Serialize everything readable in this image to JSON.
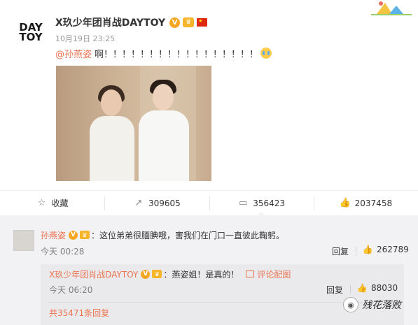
{
  "post": {
    "avatar_text_line1": "DAY",
    "avatar_text_line2": "TOY",
    "username": "X玖少年团肖战DAYTOY",
    "verified_badge": "V",
    "crown_badge": "♛",
    "timestamp": "10月19日 23:25",
    "mention": "@孙燕姿",
    "text": "啊！！！！！！！！！！！！！！！！！",
    "emoji": "cry-emoji",
    "image": "photo of woman and man in white standing in front of a door"
  },
  "actions": [
    {
      "icon": "star-icon",
      "glyph": "☆",
      "label": "收藏"
    },
    {
      "icon": "share-icon",
      "glyph": "↗",
      "label": "309605"
    },
    {
      "icon": "comment-icon",
      "glyph": "▭",
      "label": "356423"
    },
    {
      "icon": "like-icon",
      "glyph": "👍",
      "label": "2037458"
    }
  ],
  "comment": {
    "name": "孙燕姿",
    "verified_badge": "V",
    "crown_badge": "♛",
    "text": "：这位弟弟很腼腆哦，害我们在门口一直彼此鞠躬。",
    "time": "今天 00:28",
    "reply_label": "回复",
    "likes": "262789"
  },
  "sub_comment": {
    "name": "X玖少年团肖战DAYTOY",
    "verified_badge": "V",
    "crown_badge": "♛",
    "text": "：燕姿姐！是真的！",
    "pic_link": "评论配图",
    "time": "今天 06:20",
    "reply_label": "回复",
    "likes": "88030",
    "total_replies": "共35471条回复"
  },
  "watermark": {
    "text": "残花落败"
  },
  "colors": {
    "accent": "#eb7350",
    "badge": "#f5a623",
    "comment_bg": "#f2f2f5"
  }
}
